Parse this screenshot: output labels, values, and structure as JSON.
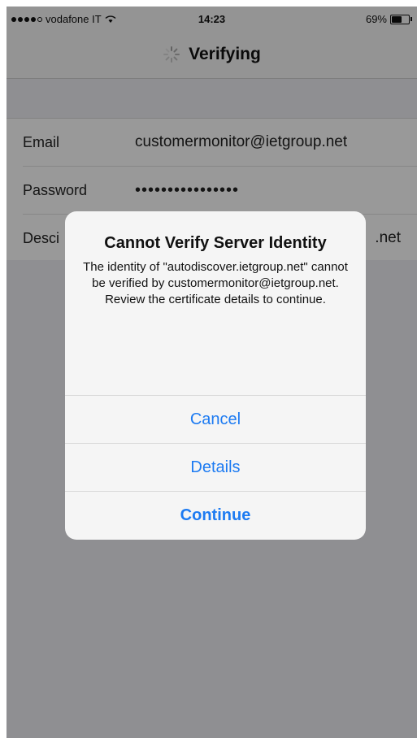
{
  "status_bar": {
    "carrier": "vodafone IT",
    "time": "14:23",
    "battery": "69%",
    "battery_level": 0.69
  },
  "nav": {
    "title": "Verifying"
  },
  "form": {
    "email_label": "Email",
    "email_value": "customermonitor@ietgroup.net",
    "password_label": "Password",
    "password_value": "••••••••••••••••",
    "description_label": "Desci",
    "description_value_visible": ".net"
  },
  "alert": {
    "title": "Cannot Verify Server Identity",
    "message": "The identity of \"autodiscover.ietgroup.net\" cannot be verified by customermonitor@ietgroup.net. Review the certificate details to continue.",
    "buttons": {
      "cancel": "Cancel",
      "details": "Details",
      "continue": "Continue"
    }
  },
  "colors": {
    "accent": "#1d7bf2"
  }
}
